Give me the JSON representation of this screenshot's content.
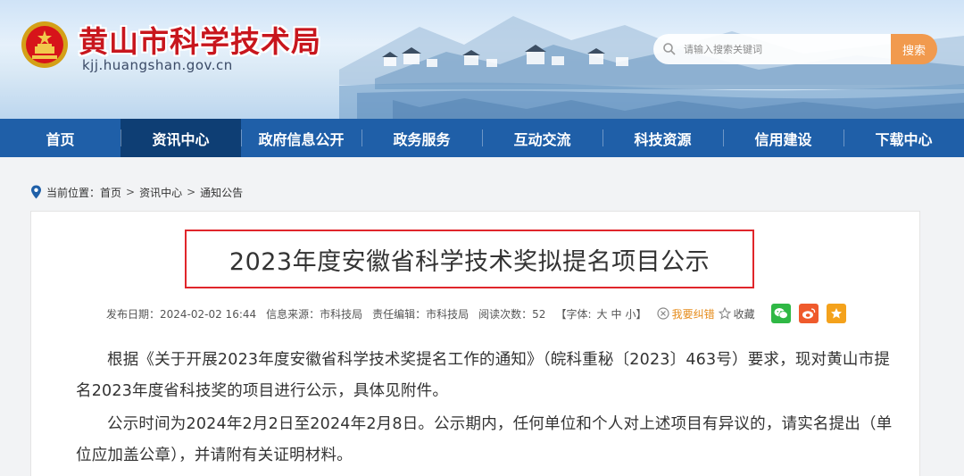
{
  "site": {
    "title": "黄山市科学技术局",
    "domain": "kjj.huangshan.gov.cn"
  },
  "search": {
    "placeholder": "请输入搜索关键词",
    "button_label": "搜索"
  },
  "nav": {
    "items": [
      {
        "label": "首页",
        "active": false
      },
      {
        "label": "资讯中心",
        "active": true
      },
      {
        "label": "政府信息公开",
        "active": false
      },
      {
        "label": "政务服务",
        "active": false
      },
      {
        "label": "互动交流",
        "active": false
      },
      {
        "label": "科技资源",
        "active": false
      },
      {
        "label": "信用建设",
        "active": false
      },
      {
        "label": "下载中心",
        "active": false
      }
    ]
  },
  "breadcrumb": {
    "prefix": "当前位置：",
    "items": [
      "首页",
      "资讯中心",
      "通知公告"
    ],
    "separator": ">"
  },
  "article": {
    "title": "2023年度安徽省科学技术奖拟提名项目公示",
    "meta": {
      "publish_date": "发布日期：2024-02-02 16:44",
      "source": "信息来源：市科技局",
      "editor": "责任编辑：市科技局",
      "views": "阅读次数：52",
      "font_prefix": "【字体:",
      "font_large": "大",
      "font_medium": "中",
      "font_small": "小",
      "font_suffix": "】",
      "report_error": "我要纠错",
      "favorite": "收藏"
    },
    "paragraphs": [
      "根据《关于开展2023年度安徽省科学技术奖提名工作的通知》（皖科重秘〔2023〕463号）要求，现对黄山市提名2023年度省科技奖的项目进行公示，具体见附件。",
      "公示时间为2024年2月2日至2024年2月8日。公示期内，任何单位和个人对上述项目有异议的，请实名提出（单位应加盖公章），并请附有关证明材料。"
    ]
  },
  "colors": {
    "nav_bg": "#1f5fa8",
    "nav_active": "#0e3e74",
    "title_red": "#c8161d",
    "highlight_box": "#e0262b",
    "search_button": "#f19a4e",
    "wechat": "#2fb845",
    "weibo": "#ef5a2c",
    "favorite": "#f4a21c"
  },
  "icons": [
    "national-emblem-icon",
    "search-icon",
    "location-pin-icon",
    "error-report-icon",
    "star-icon",
    "wechat-icon",
    "weibo-icon",
    "favorite-star-icon"
  ]
}
